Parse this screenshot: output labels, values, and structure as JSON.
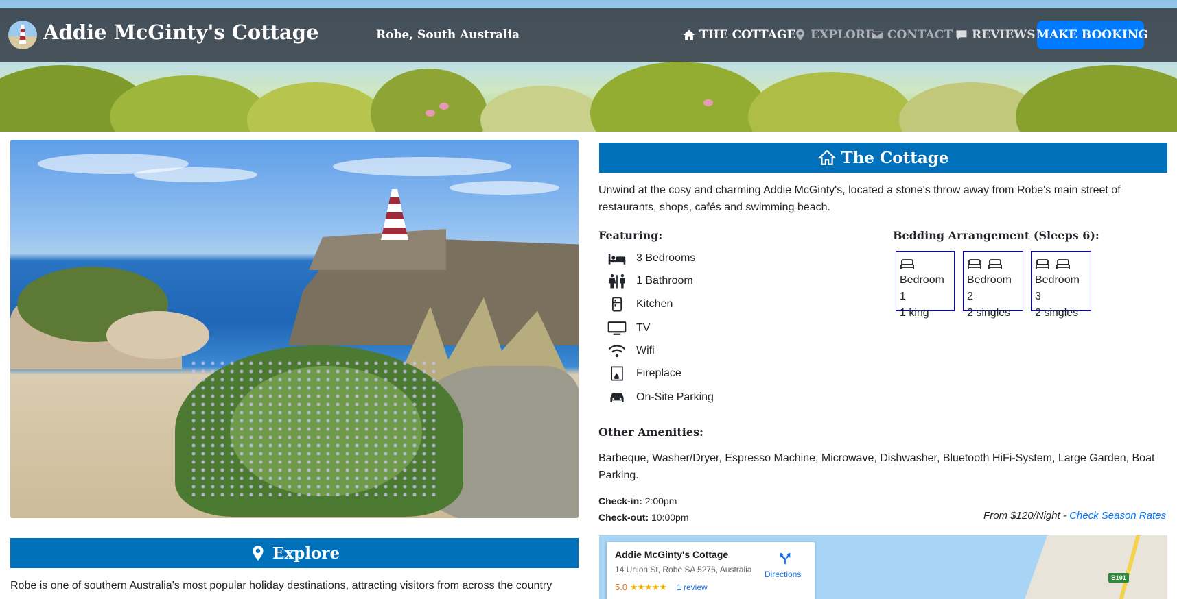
{
  "header": {
    "title": "Addie McGinty's Cottage",
    "location": "Robe, South Australia",
    "nav": [
      {
        "label": "THE COTTAGE",
        "icon": "home-icon",
        "active": true
      },
      {
        "label": "EXPLORE",
        "icon": "map-marker-icon",
        "active": false
      },
      {
        "label": "CONTACT",
        "icon": "envelope-icon",
        "active": false
      },
      {
        "label": "REVIEWS",
        "icon": "comment-icon",
        "active": false
      }
    ],
    "booking_label": "MAKE BOOKING",
    "booking_color": "#007bff"
  },
  "cottage": {
    "heading": "The Cottage",
    "intro": "Unwind at the cosy and charming Addie McGinty's, located a stone's throw away from Robe's main street of restaurants, shops, cafés and swimming beach.",
    "featuring_title": "Featuring:",
    "features": [
      {
        "label": "3 Bedrooms",
        "icon": "bed-icon"
      },
      {
        "label": "1 Bathroom",
        "icon": "restroom-icon"
      },
      {
        "label": "Kitchen",
        "icon": "fridge-icon"
      },
      {
        "label": "TV",
        "icon": "tv-icon"
      },
      {
        "label": "Wifi",
        "icon": "wifi-icon"
      },
      {
        "label": "Fireplace",
        "icon": "fireplace-icon"
      },
      {
        "label": "On-Site Parking",
        "icon": "car-icon"
      }
    ],
    "bedding_title": "Bedding Arrangement (Sleeps 6):",
    "bedrooms": [
      {
        "name": "Bedroom 1",
        "beds": "1 king",
        "bed_icons": 1
      },
      {
        "name": "Bedroom 2",
        "beds": "2 singles",
        "bed_icons": 2
      },
      {
        "name": "Bedroom 3",
        "beds": "2 singles",
        "bed_icons": 2
      }
    ],
    "amenities_title": "Other Amenities:",
    "amenities": "Barbeque, Washer/Dryer, Espresso Machine, Microwave, Dishwasher, Bluetooth HiFi-System, Large Garden, Boat Parking.",
    "checkin_label": "Check-in:",
    "checkin_time": "2:00pm",
    "checkout_label": "Check-out:",
    "checkout_time": "10:00pm",
    "rates_prefix": "From $120/Night - ",
    "rates_link": "Check Season Rates"
  },
  "explore": {
    "heading": "Explore",
    "intro": "Robe is one of southern Australia's most popular holiday destinations, attracting visitors from across the country"
  },
  "map": {
    "place_name": "Addie McGinty's Cottage",
    "address": "14 Union St, Robe SA 5276, Australia",
    "rating": "5.0",
    "stars": "★★★★★",
    "reviews": "1 review",
    "directions": "Directions",
    "road_label": "B101"
  },
  "colors": {
    "section_header": "#0070bb",
    "link": "#007bff",
    "bedroom_border": "#0000ee"
  }
}
